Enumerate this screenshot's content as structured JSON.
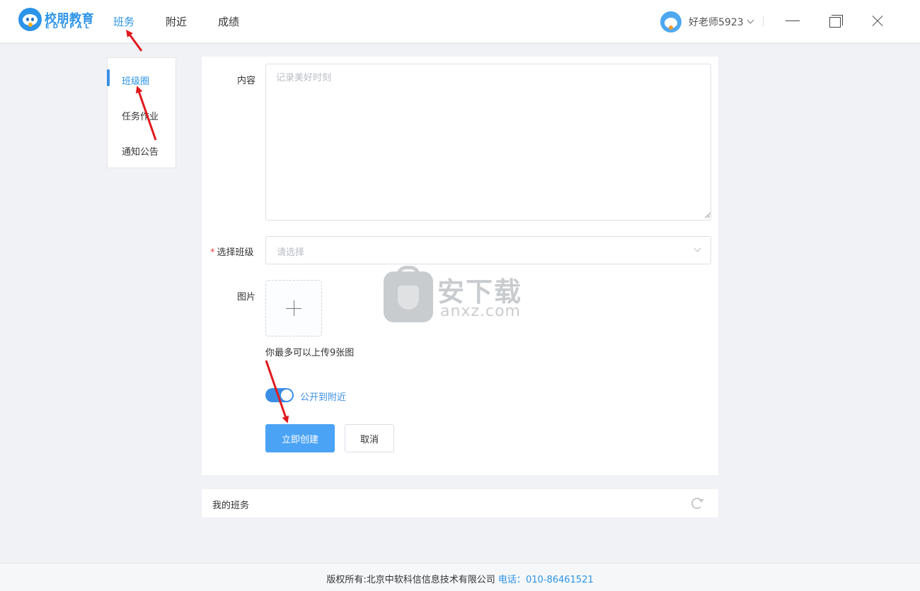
{
  "header": {
    "logo_cn": "校朋教育",
    "logo_en": "EDUPAL",
    "nav": [
      "班务",
      "附近",
      "成绩"
    ],
    "active_nav": 0,
    "username": "好老师5923"
  },
  "sidebar": {
    "items": [
      "班级圈",
      "任务作业",
      "通知公告"
    ],
    "active": 0
  },
  "form": {
    "content_label": "内容",
    "content_placeholder": "记录美好时刻",
    "content_value": "",
    "class_required_mark": "*",
    "class_label": "选择班级",
    "class_placeholder": "请选择",
    "picture_label": "图片",
    "upload_hint": "你最多可以上传9张图",
    "public_toggle_label": "公开到附近",
    "public_toggle_on": true,
    "submit_label": "立即创建",
    "cancel_label": "取消"
  },
  "my_class": {
    "title": "我的班务"
  },
  "footer": {
    "copyright": "版权所有:北京中软科信信息技术有限公司",
    "phone_label": "电话：",
    "phone_number": "010-86461521"
  },
  "watermark": {
    "text": "安下载",
    "sub": "anxz.com"
  },
  "colors": {
    "accent": "#2b93e8",
    "primary_button": "#4ba3f5",
    "required": "#e64545",
    "annotation_arrow": "#e0191d"
  },
  "icons": [
    "logo-icon",
    "avatar-icon",
    "chevron-down-icon",
    "minimize-icon",
    "maximize-icon",
    "close-icon",
    "plus-icon",
    "refresh-icon"
  ]
}
